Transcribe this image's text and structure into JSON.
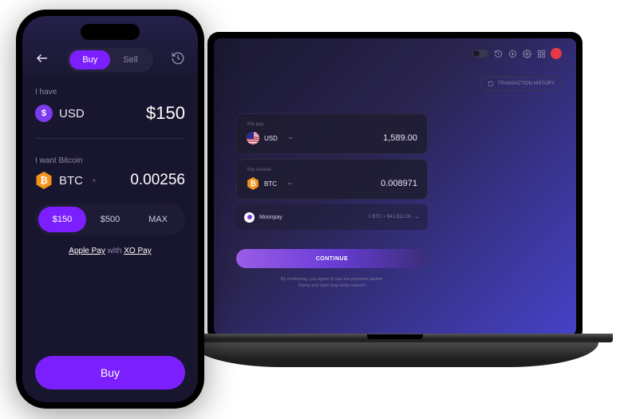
{
  "phone": {
    "tabs": {
      "buy": "Buy",
      "sell": "Sell"
    },
    "have": {
      "label": "I have",
      "ticker": "USD",
      "amount": "$150"
    },
    "want": {
      "label": "I want Bitcoin",
      "ticker": "BTC",
      "amount": "0.00256"
    },
    "quick": [
      "$150",
      "$500",
      "MAX"
    ],
    "pay": {
      "apple": "Apple Pay",
      "with": "with",
      "xo": "XO Pay"
    },
    "buy_btn": "Buy"
  },
  "laptop": {
    "history_label": "TRANSACTION HISTORY",
    "pay": {
      "label": "You pay",
      "ticker": "USD",
      "amount": "1,589.00"
    },
    "receive": {
      "label": "You receive",
      "ticker": "BTC",
      "amount": "0.008971"
    },
    "provider": {
      "name": "Moonpay",
      "rate": "1 BTC ≈ $41,812.00"
    },
    "continue": "CONTINUE",
    "disclaimer1": "By continuing, you agree to use our payment partner",
    "disclaimer2": "Ramp and open buy.ramp.network"
  }
}
